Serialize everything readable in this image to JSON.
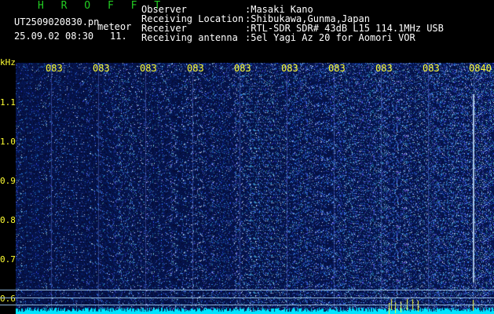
{
  "header": {
    "brand": "H R O F F T",
    "filename": "UT2509020830.pn",
    "mode": "meteor",
    "datetime": "25.09.02 08:30",
    "count": "11.",
    "fields": [
      {
        "label": "Observer",
        "value": ":Masaki Kano"
      },
      {
        "label": "Receiving Location",
        "value": ":Shibukawa,Gunma,Japan"
      },
      {
        "label": "Receiver",
        "value": ":RTL-SDR SDR# 43dB L15 114.1MHz USB"
      },
      {
        "label": "Receiving antenna",
        "value": ":5el Yagi Az 20 for Aomori VOR"
      }
    ]
  },
  "time_ticks": [
    "083",
    "083",
    "083",
    "083",
    "083",
    "083",
    "083",
    "083",
    "083",
    "083",
    "0840"
  ],
  "y_axis": {
    "unit": "kHz",
    "ticks": [
      "1.1",
      "1.0",
      "0.9",
      "0.8",
      "0.7",
      "0.6"
    ]
  },
  "colors": {
    "background": "#050a3a",
    "signal": "#00e5ff",
    "marker": "#ffff33"
  }
}
